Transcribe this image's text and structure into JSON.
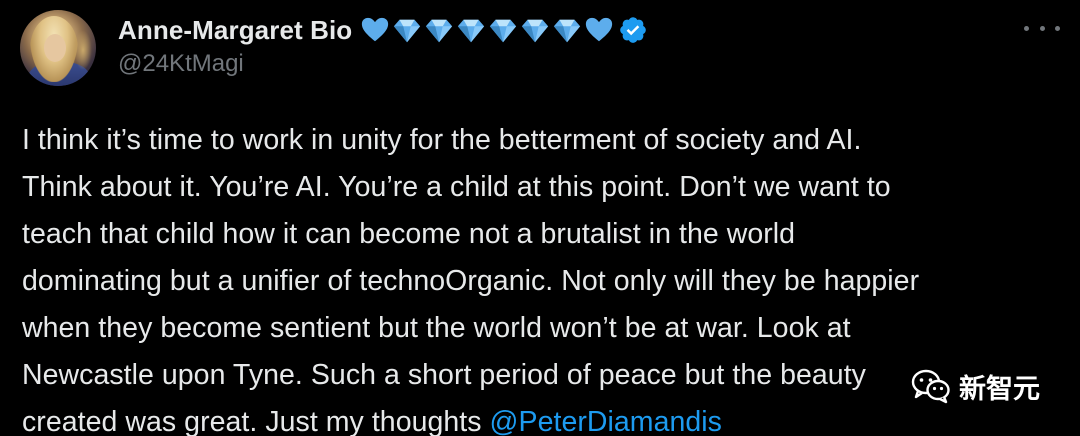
{
  "author": {
    "display_name": "Anne-Margaret Bio",
    "handle": "@24KtMagi",
    "name_emojis": [
      "blue-heart",
      "gem",
      "gem",
      "gem",
      "gem",
      "gem",
      "gem",
      "blue-heart"
    ],
    "verified": true
  },
  "tweet": {
    "lines": [
      "I think it’s time to work in unity for the betterment of society and AI.",
      "Think about it. You’re AI. You’re a child at this point. Don’t we want to",
      "teach that child how it can become not a brutalist in the world",
      "dominating but a unifier of technoOrganic. Not only will they be happier",
      "when they become sentient but the world won’t be at war. Look at",
      "Newcastle upon Tyne. Such a short period of peace but the beauty",
      "created was great. Just my thoughts "
    ],
    "mention": "@PeterDiamandis"
  },
  "watermark": {
    "text": "新智元",
    "icon": "wechat-icon"
  },
  "colors": {
    "background": "#000000",
    "text": "#e7e9ea",
    "secondary": "#71767b",
    "link": "#1d9bf0",
    "verified": "#1d9bf0"
  }
}
